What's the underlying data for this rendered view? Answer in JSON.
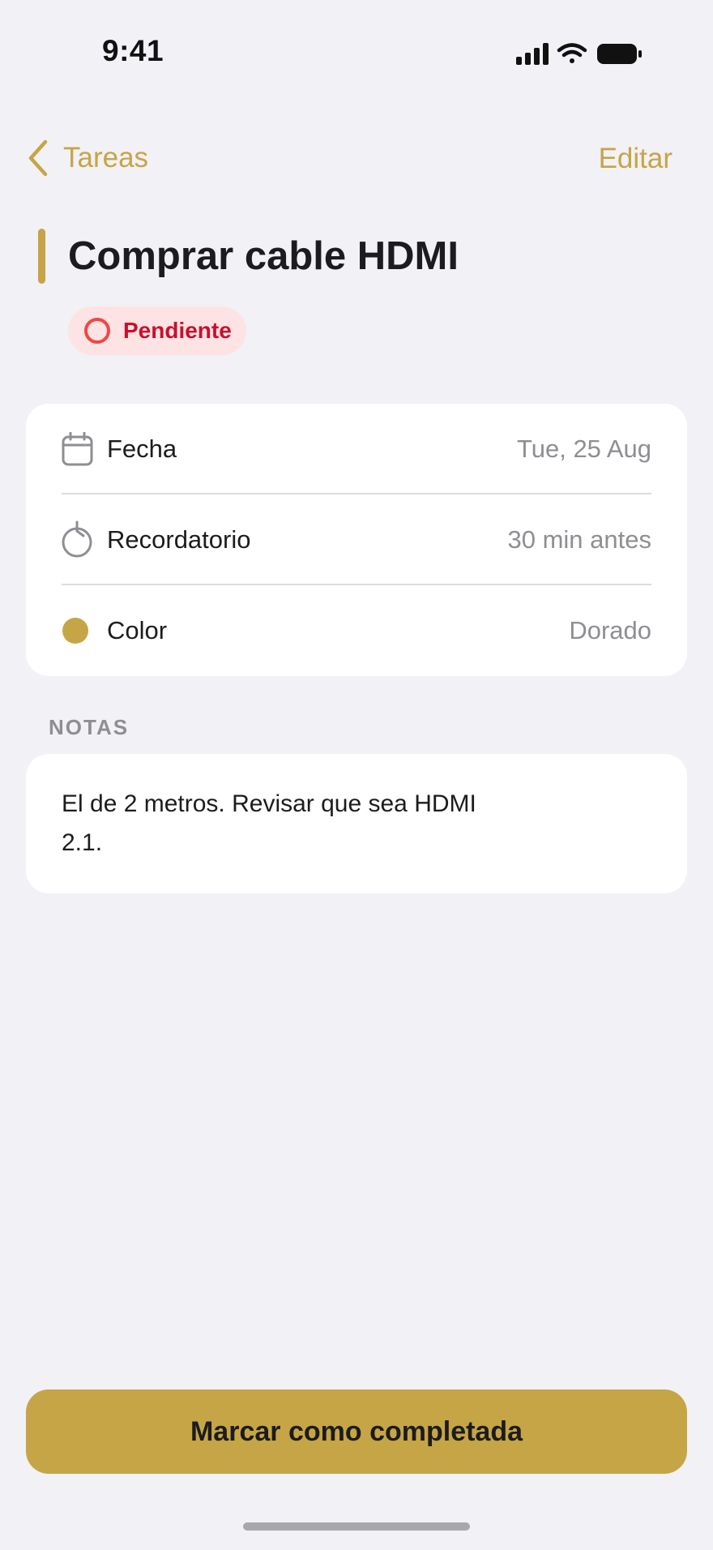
{
  "status_bar": {
    "time": "9:41"
  },
  "nav": {
    "back_label": "Tareas",
    "edit_label": "Editar"
  },
  "task": {
    "title": "Comprar cable HDMI",
    "status": "Pendiente",
    "accent_color": "#c6a546",
    "status_color": "#c8102e"
  },
  "details": [
    {
      "icon": "calendar-icon",
      "label": "Fecha",
      "value": "Tue, 25 Aug"
    },
    {
      "icon": "timer-icon",
      "label": "Recordatorio",
      "value": "30 min antes"
    },
    {
      "icon": "color-dot-icon",
      "label": "Color",
      "value": "Dorado"
    }
  ],
  "notes": {
    "heading": "NOTAS",
    "text": "El de 2 metros. Revisar que sea HDMI 2.1."
  },
  "actions": {
    "complete_label": "Marcar como completada"
  }
}
